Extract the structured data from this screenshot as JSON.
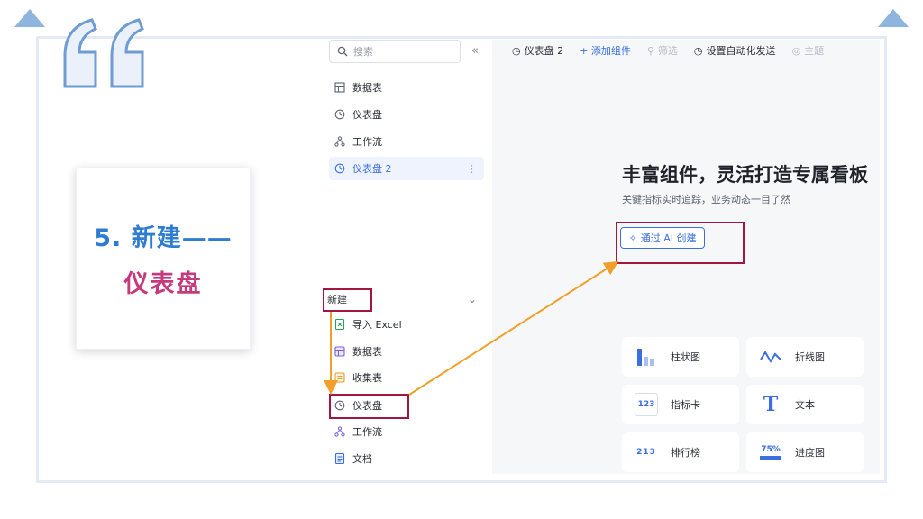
{
  "slide": {
    "title_line1": "5. 新建——",
    "title_line2": "仪表盘",
    "colors": {
      "title_blue": "#2f7dd1",
      "title_magenta": "#c53a7d",
      "highlight": "#a3163f",
      "arrow": "#f0a02a"
    }
  },
  "sidebar": {
    "search_placeholder": "搜索",
    "collapse_icon": "double-chevron-left-icon",
    "items": [
      {
        "label": "数据表",
        "icon": "table-icon"
      },
      {
        "label": "仪表盘",
        "icon": "dashboard-icon"
      },
      {
        "label": "工作流",
        "icon": "workflow-icon"
      },
      {
        "label": "仪表盘 2",
        "icon": "dashboard-icon",
        "active": true
      }
    ],
    "new_menu": {
      "label": "新建",
      "items": [
        {
          "label": "导入 Excel",
          "icon": "excel-icon"
        },
        {
          "label": "数据表",
          "icon": "table-icon"
        },
        {
          "label": "收集表",
          "icon": "form-icon"
        },
        {
          "label": "仪表盘",
          "icon": "dashboard-icon"
        },
        {
          "label": "工作流",
          "icon": "workflow-icon"
        },
        {
          "label": "文档",
          "icon": "doc-icon"
        }
      ]
    }
  },
  "toolbar": {
    "dashboard_name": "仪表盘 2",
    "add_component": "+ 添加组件",
    "filter": "筛选",
    "auto_send": "设置自动化发送",
    "theme": "主题"
  },
  "main": {
    "hero_title": "丰富组件，灵活打造专属看板",
    "hero_subtitle": "关键指标实时追踪，业务动态一目了然",
    "ai_button": "通过 AI 创建",
    "components": [
      {
        "label": "柱状图",
        "icon": "bar-chart-icon"
      },
      {
        "label": "折线图",
        "icon": "line-chart-icon"
      },
      {
        "label": "指标卡",
        "icon": "metric-card-icon",
        "icon_text": "123"
      },
      {
        "label": "文本",
        "icon": "text-icon",
        "icon_text": "T"
      },
      {
        "label": "排行榜",
        "icon": "ranking-icon",
        "icon_text": "213"
      },
      {
        "label": "进度图",
        "icon": "progress-icon",
        "icon_text": "75%"
      }
    ]
  }
}
